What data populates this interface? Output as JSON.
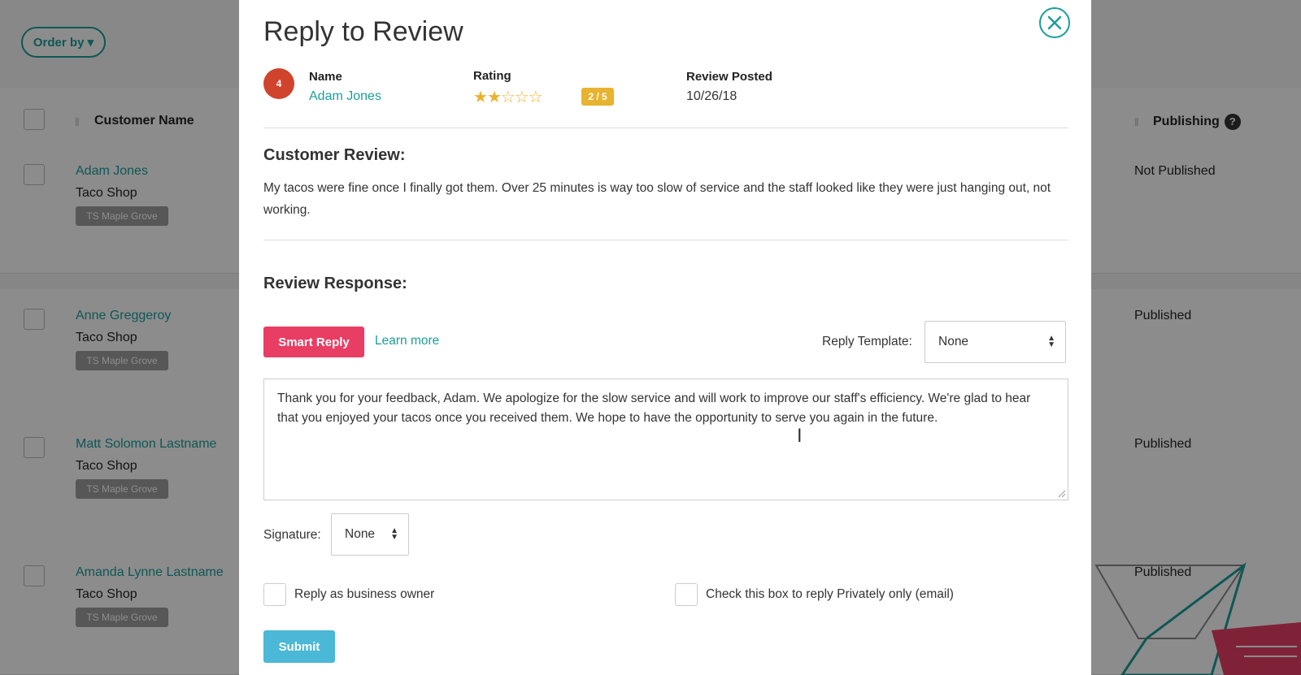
{
  "background": {
    "order_by": "Order by ▾",
    "columns": {
      "customer_name": "Customer Name",
      "publishing": "Publishing",
      "help": "?"
    },
    "rows": [
      {
        "name": "Adam Jones",
        "shop": "Taco Shop",
        "tag": "TS Maple Grove",
        "status": "Not Published"
      },
      {
        "name": "Anne Greggeroy",
        "shop": "Taco Shop",
        "tag": "TS Maple Grove",
        "status": "Published"
      },
      {
        "name": "Matt Solomon Lastname",
        "shop": "Taco Shop",
        "tag": "TS Maple Grove",
        "status": "Published"
      },
      {
        "name": "Amanda Lynne Lastname",
        "shop": "Taco Shop",
        "tag": "TS Maple Grove",
        "status": "Published"
      }
    ]
  },
  "modal": {
    "title": "Reply to Review",
    "close_icon": "close-icon",
    "avatar_initial": "4",
    "name_label": "Name",
    "name_value": "Adam Jones",
    "rating_label": "Rating",
    "rating": {
      "filled": 2,
      "total": 5,
      "badge": "2 / 5"
    },
    "posted_label": "Review Posted",
    "posted_value": "10/26/18",
    "customer_review_title": "Customer Review:",
    "customer_review_text": "My tacos were fine once I finally got them. Over 25 minutes is way too slow of service and the staff looked like they were just hanging out, not working.",
    "response_title": "Review Response:",
    "smart_reply": "Smart Reply",
    "learn_more": "Learn more",
    "reply_template_label": "Reply Template:",
    "reply_template_value": "None",
    "response_text": "Thank you for your feedback, Adam. We apologize for the slow service and will work to improve our staff's efficiency. We're glad to hear that you enjoyed your tacos once you received them. We hope to have the opportunity to serve you again in the future.",
    "signature_label": "Signature:",
    "signature_value": "None",
    "reply_owner_label": "Reply as business owner",
    "reply_private_label": "Check this box to reply Privately only (email)",
    "submit": "Submit"
  },
  "colors": {
    "teal": "#1a9e9a",
    "pink": "#e83e64",
    "star": "#e8b330",
    "submit": "#4ab8d6",
    "avatar": "#d0432d"
  }
}
